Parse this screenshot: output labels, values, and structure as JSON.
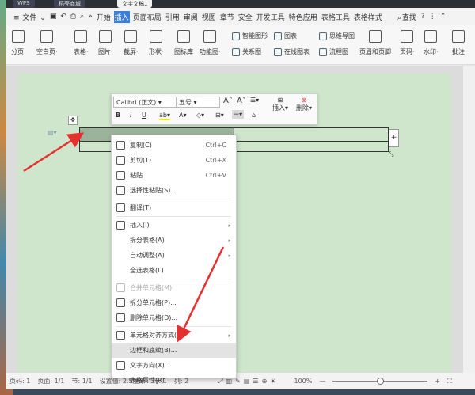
{
  "tabs": [
    "WPS",
    "稻壳商城",
    "文字文稿1"
  ],
  "menu": {
    "file": "文件",
    "items": [
      "开始",
      "插入",
      "页面布局",
      "引用",
      "审阅",
      "视图",
      "章节",
      "安全",
      "开发工具",
      "特色应用",
      "表格工具",
      "表格样式"
    ],
    "active": "插入",
    "search": "查找",
    "help": "?"
  },
  "ribbon": {
    "big": [
      "分页",
      "空白页",
      "表格",
      "图片",
      "截屏",
      "形状",
      "图标库",
      "功能图",
      "页眉和页脚",
      "页码",
      "水印",
      "批注"
    ],
    "small": [
      "智能图形",
      "关系图",
      "图表",
      "在线图表",
      "思维导图",
      "流程图"
    ]
  },
  "mini_toolbar": {
    "font": "Calibri (正文)",
    "size": "五号",
    "insert": "插入",
    "delete": "删除",
    "bold": "B",
    "italic": "I",
    "underline": "U"
  },
  "context_menu": [
    {
      "label": "复制(C)",
      "shortcut": "Ctrl+C",
      "icon": "copy-icon"
    },
    {
      "label": "剪切(T)",
      "shortcut": "Ctrl+X",
      "icon": "cut-icon"
    },
    {
      "label": "粘贴",
      "shortcut": "Ctrl+V",
      "icon": "paste-icon"
    },
    {
      "label": "选择性粘贴(S)...",
      "icon": "paste-special-icon"
    },
    {
      "label": "翻译(T)",
      "icon": "translate-icon"
    },
    {
      "label": "插入(I)",
      "icon": "insert-table-icon",
      "submenu": true
    },
    {
      "label": "拆分表格(A)",
      "submenu": true
    },
    {
      "label": "自动调整(A)",
      "submenu": true
    },
    {
      "label": "全选表格(L)"
    },
    {
      "label": "合并单元格(M)",
      "icon": "merge-cells-icon",
      "disabled": true
    },
    {
      "label": "拆分单元格(P)...",
      "icon": "split-cells-icon"
    },
    {
      "label": "删除单元格(D)...",
      "icon": "delete-cells-icon"
    },
    {
      "label": "单元格对齐方式(G)",
      "icon": "cell-align-icon",
      "submenu": true
    },
    {
      "label": "边框和底纹(B)...",
      "highlighted": true
    },
    {
      "label": "文字方向(X)...",
      "icon": "text-direction-icon"
    },
    {
      "label": "表格属性(R)..."
    }
  ],
  "status": {
    "page": "页码: 1",
    "pages": "页面: 1/1",
    "section": "节: 1/1",
    "setting": "设置值: 2.5厘米",
    "row": "行: 1",
    "col": "列: 2",
    "zoom": "100%"
  },
  "colors": {
    "page": "#cfe6cc",
    "arrow": "#e53030",
    "accent": "#3a7fd8"
  }
}
